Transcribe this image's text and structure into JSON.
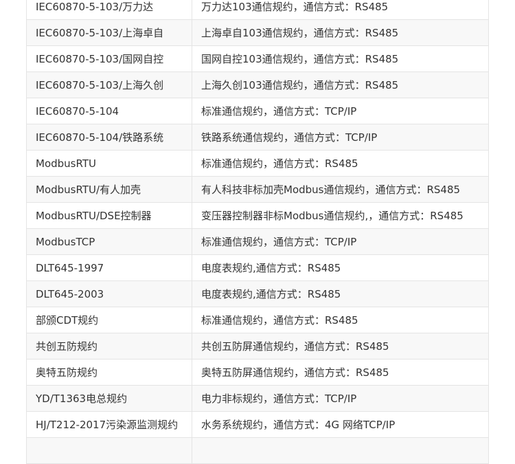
{
  "table": {
    "rows": [
      {
        "protocol": "IEC60870-5-103/万力达",
        "description": "万力达103通信规约，通信方式：RS485"
      },
      {
        "protocol": "IEC60870-5-103/上海卓自",
        "description": "上海卓自103通信规约，通信方式：RS485"
      },
      {
        "protocol": "IEC60870-5-103/国网自控",
        "description": "国网自控103通信规约，通信方式：RS485"
      },
      {
        "protocol": "IEC60870-5-103/上海久创",
        "description": "上海久创103通信规约，通信方式：RS485"
      },
      {
        "protocol": "IEC60870-5-104",
        "description": "标准通信规约，通信方式：TCP/IP"
      },
      {
        "protocol": "IEC60870-5-104/铁路系统",
        "description": "铁路系统通信规约，通信方式：TCP/IP"
      },
      {
        "protocol": "ModbusRTU",
        "description": "标准通信规约，通信方式：RS485"
      },
      {
        "protocol": "ModbusRTU/有人加壳",
        "description": "有人科技非标加壳Modbus通信规约，通信方式：RS485"
      },
      {
        "protocol": "ModbusRTU/DSE控制器",
        "description": "变压器控制器非标Modbus通信规约,，通信方式：RS485"
      },
      {
        "protocol": "ModbusTCP",
        "description": "标准通信规约，通信方式：TCP/IP"
      },
      {
        "protocol": "DLT645-1997",
        "description": "电度表规约,通信方式：RS485"
      },
      {
        "protocol": "DLT645-2003",
        "description": "电度表规约,通信方式：RS485"
      },
      {
        "protocol": "部颁CDT规约",
        "description": "标准通信规约，通信方式：RS485"
      },
      {
        "protocol": "共创五防规约",
        "description": "共创五防屏通信规约，通信方式：RS485"
      },
      {
        "protocol": "奥特五防规约",
        "description": "奥特五防屏通信规约，通信方式：RS485"
      },
      {
        "protocol": "YD/T1363电总规约",
        "description": "电力非标规约，通信方式：TCP/IP"
      },
      {
        "protocol": "HJ/T212-2017污染源监测规约",
        "description": "水务系统规约，通信方式：4G 网络TCP/IP"
      },
      {
        "protocol": "",
        "description": ""
      }
    ]
  }
}
